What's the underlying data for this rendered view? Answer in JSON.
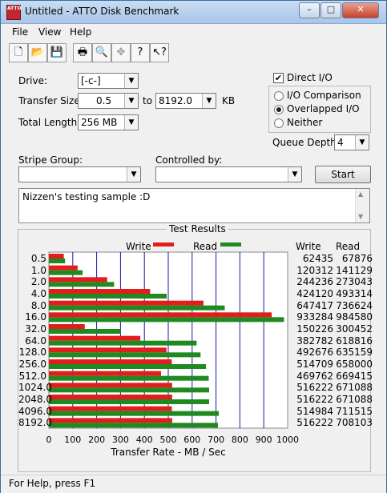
{
  "window": {
    "title": "Untitled - ATTO Disk Benchmark",
    "icon_text": "ATTO",
    "minimize": "–",
    "maximize": "□",
    "close": "✕"
  },
  "menu": [
    "File",
    "View",
    "Help"
  ],
  "toolbar": [
    "new-file-icon",
    "open-folder-icon",
    "save-icon",
    "print-icon",
    "print-preview-icon",
    "move-icon",
    "help-icon",
    "context-help-icon"
  ],
  "settings": {
    "drive_label": "Drive:",
    "drive_value": "[-c-]",
    "transfer_size_label": "Transfer Size:",
    "transfer_from": "0.5",
    "to_label": "to",
    "transfer_to": "8192.0",
    "kb_label": "KB",
    "total_length_label": "Total Length:",
    "total_length_value": "256 MB",
    "stripe_group_label": "Stripe Group:",
    "stripe_group_value": "",
    "controlled_by_label": "Controlled by:",
    "controlled_by_value": "",
    "start_label": "Start",
    "direct_io_label": "Direct I/O",
    "direct_io_checked": true,
    "io_comparison_label": "I/O Comparison",
    "overlapped_io_label": "Overlapped I/O",
    "neither_label": "Neither",
    "selected_mode": "Overlapped I/O",
    "queue_depth_label": "Queue Depth:",
    "queue_depth_value": "4",
    "notes": "Nizzen's testing sample :D"
  },
  "results_title": "Test Results",
  "legend": {
    "write": "Write",
    "read": "Read"
  },
  "columns": {
    "write": "Write",
    "read": "Read"
  },
  "colors": {
    "write": "#e31c1c",
    "read": "#1f8a1f",
    "grid": "#1a1aa8"
  },
  "chart_data": {
    "type": "bar",
    "orientation": "horizontal",
    "categories": [
      "0.5",
      "1.0",
      "2.0",
      "4.0",
      "8.0",
      "16.0",
      "32.0",
      "64.0",
      "128.0",
      "256.0",
      "512.0",
      "1024.0",
      "2048.0",
      "4096.0",
      "8192.0"
    ],
    "series": [
      {
        "name": "Write",
        "values": [
          62435,
          120312,
          244236,
          424120,
          647417,
          933284,
          150226,
          382782,
          492676,
          514709,
          469762,
          516222,
          516222,
          514984,
          516222
        ]
      },
      {
        "name": "Read",
        "values": [
          67876,
          141129,
          273043,
          493314,
          736624,
          984580,
          300452,
          618816,
          635159,
          658000,
          669415,
          671088,
          671088,
          711515,
          708103
        ]
      }
    ],
    "xlabel": "Transfer Rate - MB / Sec",
    "xticks": [
      0,
      100,
      200,
      300,
      400,
      500,
      600,
      700,
      800,
      900,
      1000
    ],
    "xlim": [
      0,
      1000
    ],
    "grid": true
  },
  "status": "For Help, press F1"
}
